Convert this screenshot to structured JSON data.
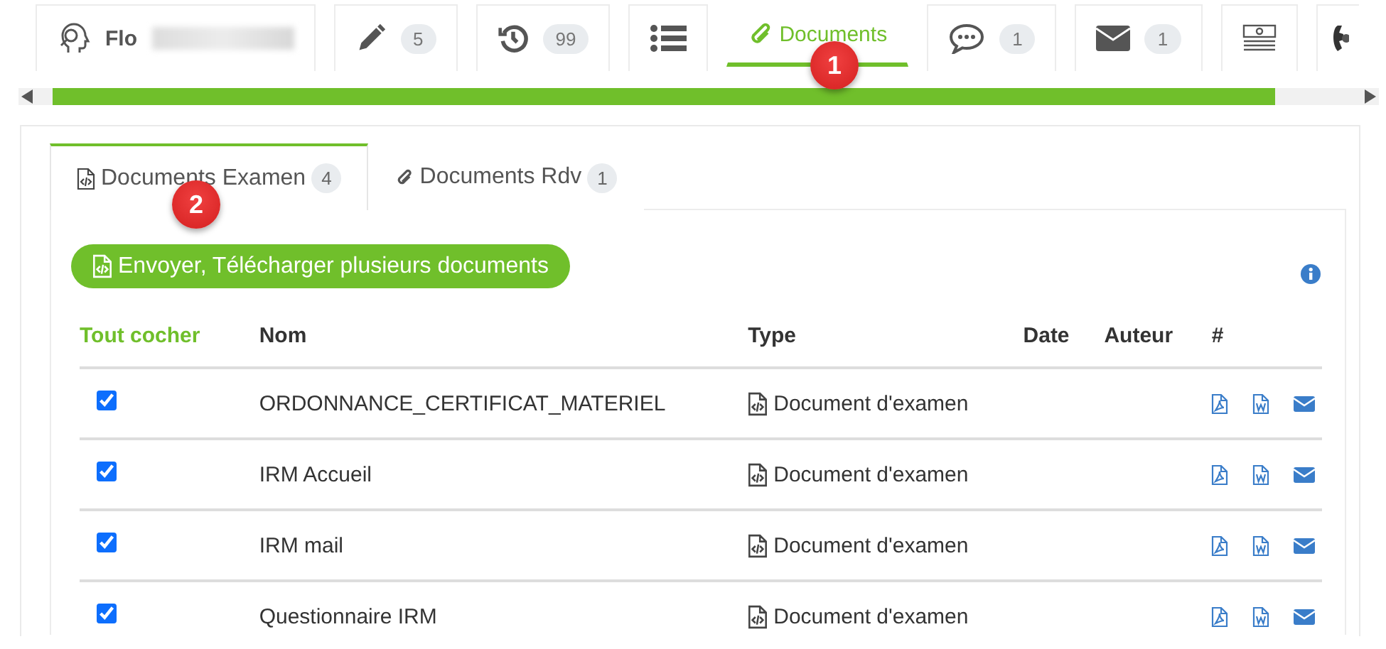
{
  "top_tabs": [
    {
      "kind": "patient",
      "label": "Flo",
      "redacted": true,
      "selected": false
    },
    {
      "kind": "edit",
      "count": "5",
      "selected": false
    },
    {
      "kind": "history",
      "count": "99",
      "selected": false
    },
    {
      "kind": "list",
      "selected": false
    },
    {
      "kind": "documents",
      "label": "Documents",
      "selected": true
    },
    {
      "kind": "comments",
      "count": "1",
      "selected": false
    },
    {
      "kind": "mail",
      "count": "1",
      "selected": false
    },
    {
      "kind": "money",
      "selected": false
    },
    {
      "kind": "phone",
      "selected": false
    }
  ],
  "callouts": [
    "1",
    "2"
  ],
  "sub_tabs": [
    {
      "kind": "exam",
      "label": "Documents Examen",
      "count": "4",
      "selected": true
    },
    {
      "kind": "rdv",
      "label": "Documents Rdv",
      "count": "1",
      "selected": false
    }
  ],
  "upload_button": "Envoyer, Télécharger plusieurs documents",
  "table": {
    "columns": [
      "Tout cocher",
      "Nom",
      "Type",
      "Date",
      "Auteur",
      "#"
    ],
    "rows": [
      {
        "checked": true,
        "name": "ORDONNANCE_CERTIFICAT_MATERIEL",
        "type": "Document d'examen"
      },
      {
        "checked": true,
        "name": "IRM Accueil",
        "type": "Document d'examen"
      },
      {
        "checked": true,
        "name": "IRM mail",
        "type": "Document d'examen"
      },
      {
        "checked": true,
        "name": "Questionnaire IRM",
        "type": "Document d'examen"
      }
    ]
  }
}
